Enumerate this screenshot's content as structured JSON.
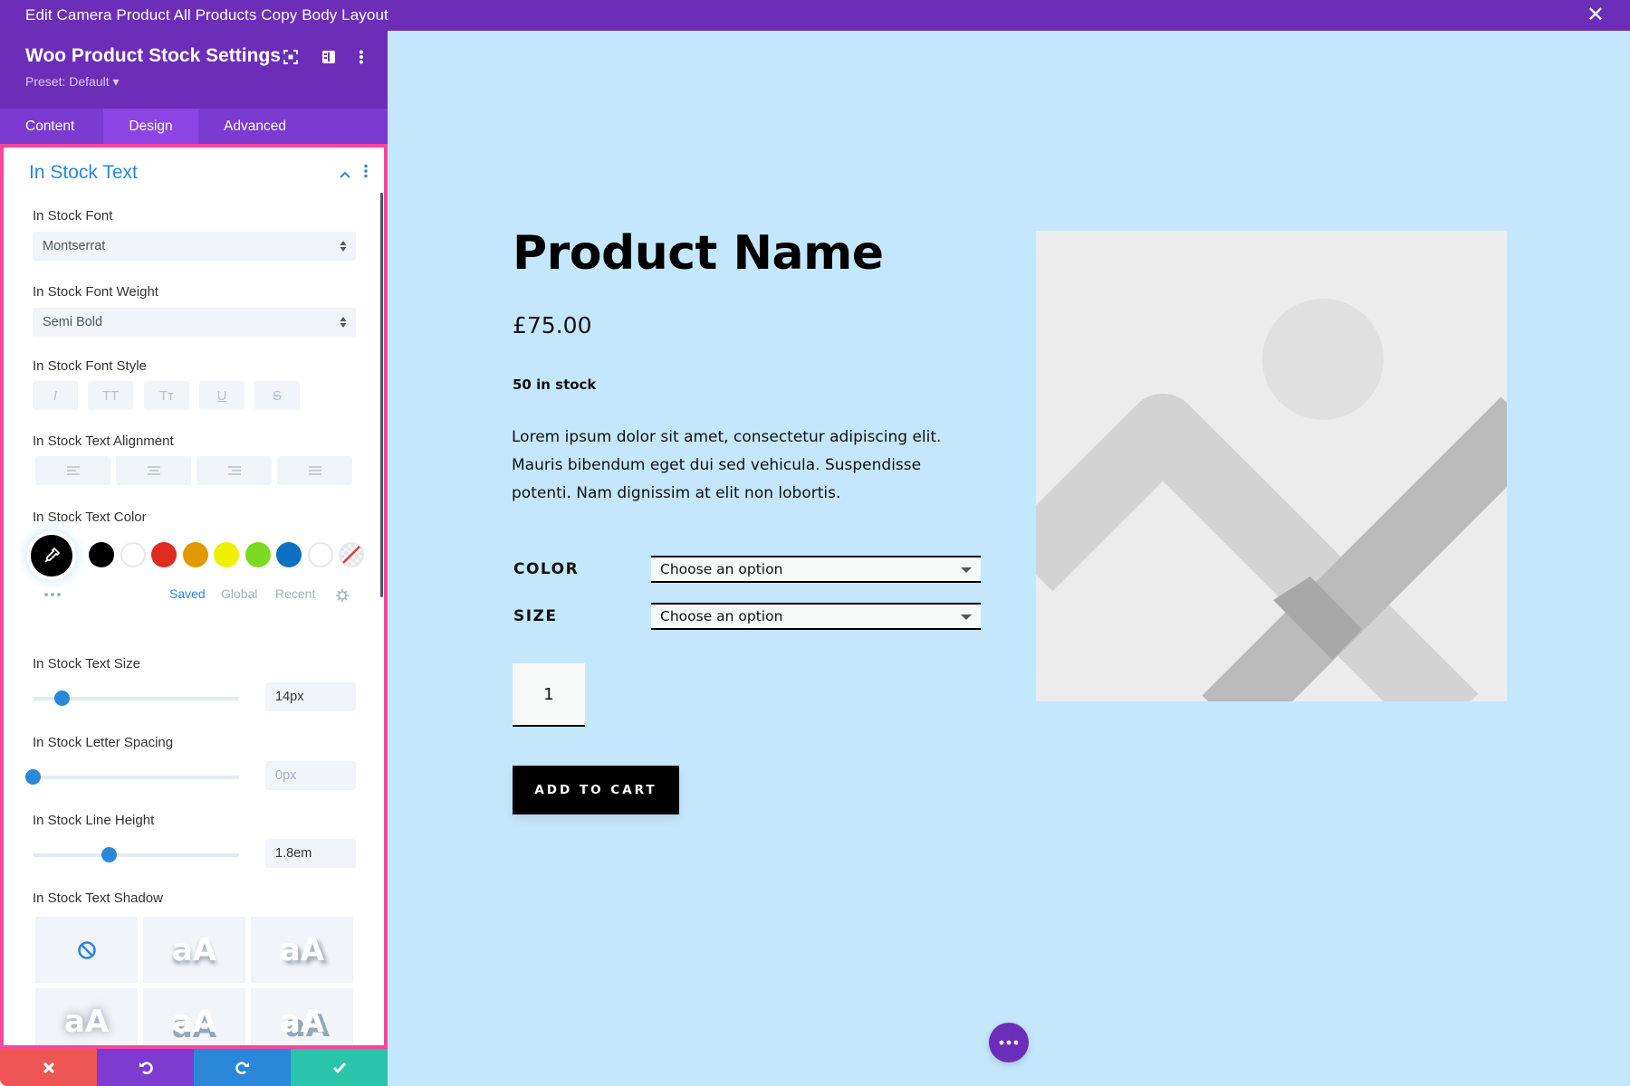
{
  "window": {
    "title": "Edit Camera Product All Products Copy Body Layout",
    "close_icon": "close-icon"
  },
  "panel": {
    "title": "Woo Product Stock Settings",
    "preset": "Preset: Default ▾",
    "header_icons": [
      "fullscreen-icon",
      "split-view-icon",
      "more-vertical-icon"
    ],
    "tabs": [
      {
        "label": "Content",
        "active": false
      },
      {
        "label": "Design",
        "active": true
      },
      {
        "label": "Advanced",
        "active": false
      }
    ],
    "section": {
      "title": "In Stock Text",
      "expanded": true
    },
    "fields": {
      "font": {
        "label": "In Stock Font",
        "value": "Montserrat"
      },
      "font_weight": {
        "label": "In Stock Font Weight",
        "value": "Semi Bold"
      },
      "font_style": {
        "label": "In Stock Font Style",
        "options": [
          {
            "name": "italic",
            "glyph": "I"
          },
          {
            "name": "uppercase",
            "glyph": "TT"
          },
          {
            "name": "capitalize",
            "glyph": "Tт"
          },
          {
            "name": "underline",
            "glyph": "U"
          },
          {
            "name": "strikethrough",
            "glyph": "S"
          }
        ]
      },
      "alignment": {
        "label": "In Stock Text Alignment",
        "options": [
          "left",
          "center",
          "right",
          "justify"
        ]
      },
      "text_color": {
        "label": "In Stock Text Color",
        "selected": "#000000",
        "swatches": [
          "#000000",
          "#ffffff",
          "#e02b20",
          "#e09900",
          "#edf000",
          "#7cda24",
          "#0c71c3",
          "#ffffff",
          "transparent"
        ],
        "palette_tabs": [
          {
            "label": "Saved",
            "active": true
          },
          {
            "label": "Global",
            "active": false
          },
          {
            "label": "Recent",
            "active": false
          }
        ]
      },
      "text_size": {
        "label": "In Stock Text Size",
        "value": "14px",
        "slider_fraction": 0.14
      },
      "letter_spacing": {
        "label": "In Stock Letter Spacing",
        "value": "0px",
        "slider_fraction": 0.0
      },
      "line_height": {
        "label": "In Stock Line Height",
        "value": "1.8em",
        "slider_fraction": 0.37
      },
      "text_shadow": {
        "label": "In Stock Text Shadow",
        "options": [
          "none",
          "aA",
          "aA",
          "aA",
          "aA",
          "aA"
        ]
      }
    },
    "bottom_actions": [
      {
        "name": "discard",
        "icon": "close-icon",
        "color": "#ef5555"
      },
      {
        "name": "undo",
        "icon": "undo-icon",
        "color": "#7e3bd0"
      },
      {
        "name": "redo",
        "icon": "redo-icon",
        "color": "#2b87da"
      },
      {
        "name": "save",
        "icon": "check-icon",
        "color": "#29c4a9"
      }
    ]
  },
  "product": {
    "name": "Product Name",
    "price": "£75.00",
    "stock": "50 in stock",
    "description": "Lorem ipsum dolor sit amet, consectetur adipiscing elit. Mauris bibendum eget dui sed vehicula. Suspendisse potenti. Nam dignissim at elit non lobortis.",
    "attributes": [
      {
        "label": "COLOR",
        "placeholder": "Choose an option"
      },
      {
        "label": "SIZE",
        "placeholder": "Choose an option"
      }
    ],
    "quantity": "1",
    "add_to_cart": "ADD TO CART",
    "image": "image-placeholder-icon"
  },
  "colors": {
    "brand_purple": "#6c2eb9",
    "tab_purple": "#7b3ad0",
    "active_tab": "#8c44e5",
    "accent_blue": "#2b87da",
    "panel_border": "#f4479d",
    "canvas_bg": "#c5e7fd"
  }
}
